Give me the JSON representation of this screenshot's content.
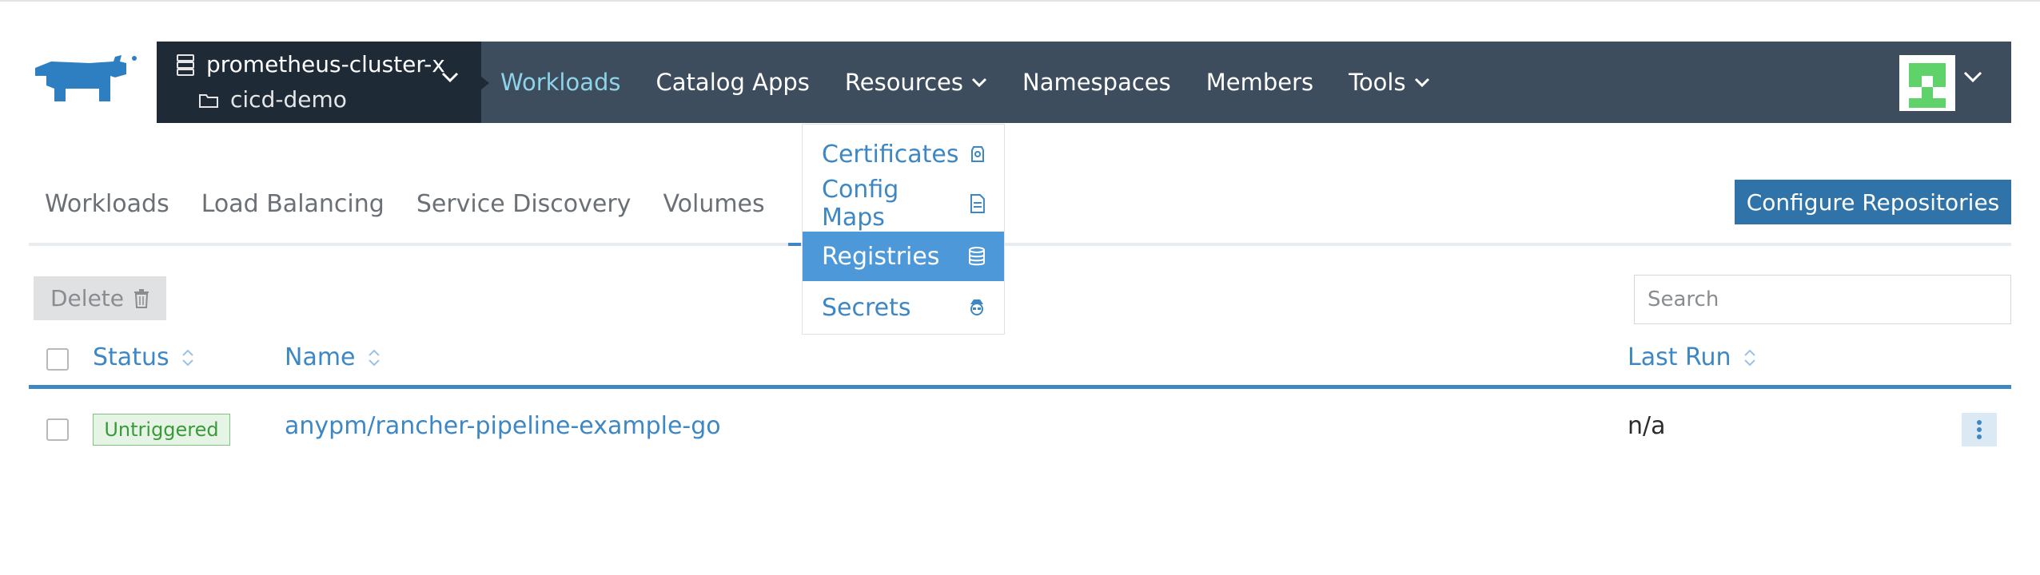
{
  "header": {
    "cluster_name": "prometheus-cluster-x",
    "project_name": "cicd-demo",
    "logo_icon": "rancher-cow-logo",
    "nav": [
      {
        "label": "Workloads",
        "active": true
      },
      {
        "label": "Catalog Apps"
      },
      {
        "label": "Resources",
        "has_dropdown": true
      },
      {
        "label": "Namespaces"
      },
      {
        "label": "Members"
      },
      {
        "label": "Tools",
        "has_dropdown": true
      }
    ]
  },
  "resources_menu": [
    {
      "label": "Certificates",
      "icon": "certificate-icon"
    },
    {
      "label": "Config Maps",
      "icon": "document-icon"
    },
    {
      "label": "Registries",
      "icon": "database-icon",
      "selected": true
    },
    {
      "label": "Secrets",
      "icon": "secret-agent-icon"
    }
  ],
  "subtabs": [
    "Workloads",
    "Load Balancing",
    "Service Discovery",
    "Volumes"
  ],
  "toolbar": {
    "configure_label": "Configure Repositories",
    "delete_label": "Delete",
    "search_placeholder": "Search"
  },
  "table": {
    "columns": [
      "Status",
      "Name",
      "Last Run"
    ],
    "rows": [
      {
        "status": "Untriggered",
        "name": "anypm/rancher-pipeline-example-go",
        "last_run": "n/a"
      }
    ]
  },
  "colors": {
    "header_bg": "#3d4d5d",
    "cluster_bg": "#1e2a36",
    "accent": "#3d87c5",
    "selected_menu": "#4d98d9",
    "badge_green": "#3a9a3a"
  }
}
